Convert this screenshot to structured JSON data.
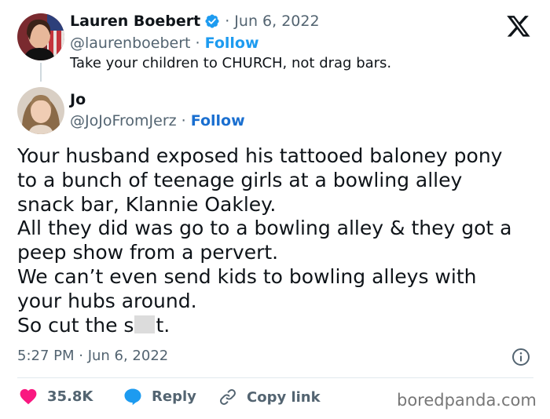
{
  "quoted_tweet": {
    "display_name": "Lauren Boebert",
    "date": "· Jun 6, 2022",
    "handle": "@laurenboebert",
    "separator": " · ",
    "follow_label": "Follow",
    "text": "Take your children to CHURCH, not drag bars."
  },
  "tweet": {
    "display_name": "Jo",
    "handle": "@JoJoFromJerz",
    "separator": " · ",
    "follow_label": "Follow",
    "body_lines": [
      "Your husband exposed his tattooed baloney pony",
      "to a bunch of teenage girls at a bowling alley",
      "snack bar, Klannie Oakley.",
      "All they did was go to a bowling alley & they got a",
      "peep show from a pervert.",
      "We can’t even send kids to bowling alleys with",
      "your hubs around."
    ],
    "last_line_start": "So cut the s",
    "last_line_end": "t.",
    "timestamp": "5:27 PM · Jun 6, 2022"
  },
  "actions": {
    "like_count": "35.8K",
    "reply_label": "Reply",
    "copy_link_label": "Copy link"
  },
  "watermark": "boredpanda.com",
  "icons": {
    "platform_logo": "x-logo-icon",
    "verified": "verified-badge-icon",
    "info": "info-icon",
    "like": "heart-icon",
    "reply": "speech-bubble-icon",
    "copy_link": "link-icon"
  },
  "colors": {
    "text_primary": "#0f1419",
    "text_secondary": "#536471",
    "follow_link": "#1d9bf0",
    "verified_badge": "#1d9bf0",
    "like_heart": "#f91880",
    "reply_bubble": "#1d9bf0",
    "divider": "#e1e8ed"
  }
}
